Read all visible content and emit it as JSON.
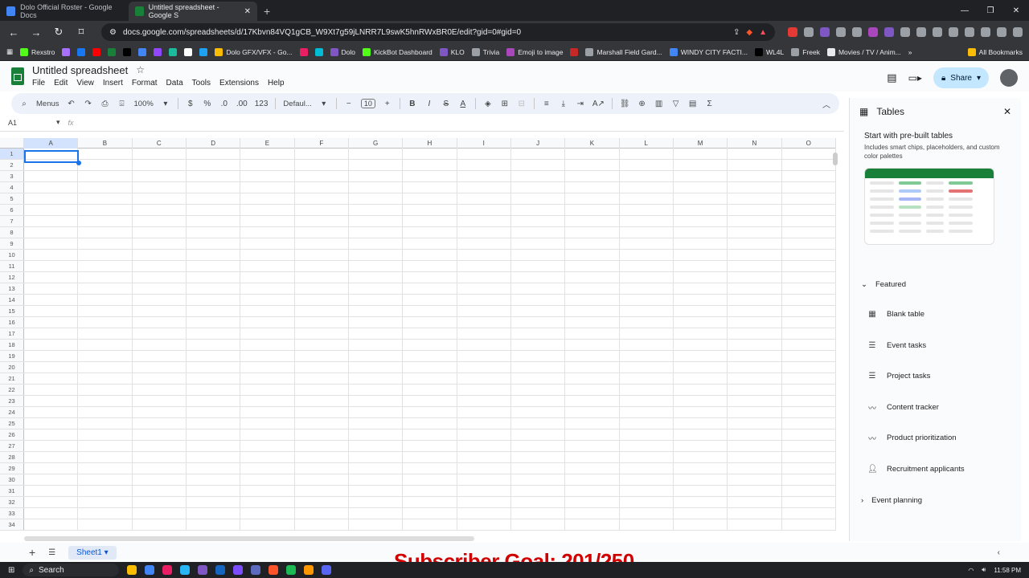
{
  "browser": {
    "tabs": [
      {
        "title": "Dolo Official Roster - Google Docs",
        "active": false
      },
      {
        "title": "Untitled spreadsheet - Google S",
        "active": true
      }
    ],
    "url": "docs.google.com/spreadsheets/d/17Kbvn84VQ1gCB_W9Xt7g59jLNRR7L9swK5hnRWxBR0E/edit?gid=0#gid=0",
    "bookmarks": [
      "Rexstro",
      "Dolo GFX/VFX - Go...",
      "Dolo",
      "KickBot Dashboard",
      "KLO",
      "Trivia",
      "Emoji to image",
      "Marshall Field Gard...",
      "WINDY CITY FACTI...",
      "WL4L",
      "Freek",
      "Movies / TV / Anim..."
    ],
    "all_bookmarks": "All Bookmarks"
  },
  "sheets": {
    "title": "Untitled spreadsheet",
    "menu": [
      "File",
      "Edit",
      "View",
      "Insert",
      "Format",
      "Data",
      "Tools",
      "Extensions",
      "Help"
    ],
    "share_label": "Share",
    "toolbar": {
      "menus": "Menus",
      "zoom": "100%",
      "currency": "$",
      "percent": "%",
      "dec_less": ".0",
      "dec_more": ".00",
      "number_format": "123",
      "font": "Defaul...",
      "font_size": "10"
    },
    "name_box": "A1",
    "fx": "fx",
    "columns": [
      "A",
      "B",
      "C",
      "D",
      "E",
      "F",
      "G",
      "H",
      "I",
      "J",
      "K",
      "L",
      "M",
      "N",
      "O"
    ],
    "rows": [
      "1",
      "2",
      "3",
      "4",
      "5",
      "6",
      "7",
      "8",
      "9",
      "10",
      "11",
      "12",
      "13",
      "14",
      "15",
      "16",
      "17",
      "18",
      "19",
      "20",
      "21",
      "22",
      "23",
      "24",
      "25",
      "26",
      "27",
      "28",
      "29",
      "30",
      "31",
      "32",
      "33",
      "34"
    ],
    "sheet_tab": "Sheet1"
  },
  "panel": {
    "title": "Tables",
    "promo_title": "Start with pre-built tables",
    "promo_sub": "Includes smart chips, placeholders, and custom color palettes",
    "featured": "Featured",
    "items": [
      "Blank table",
      "Event tasks",
      "Project tasks",
      "Content tracker",
      "Product prioritization",
      "Recruitment applicants"
    ],
    "event_planning": "Event planning"
  },
  "overlay": {
    "goal": "Subscriber Goal: 201/250"
  },
  "taskbar": {
    "search": "Search",
    "time": "11:58 PM"
  }
}
